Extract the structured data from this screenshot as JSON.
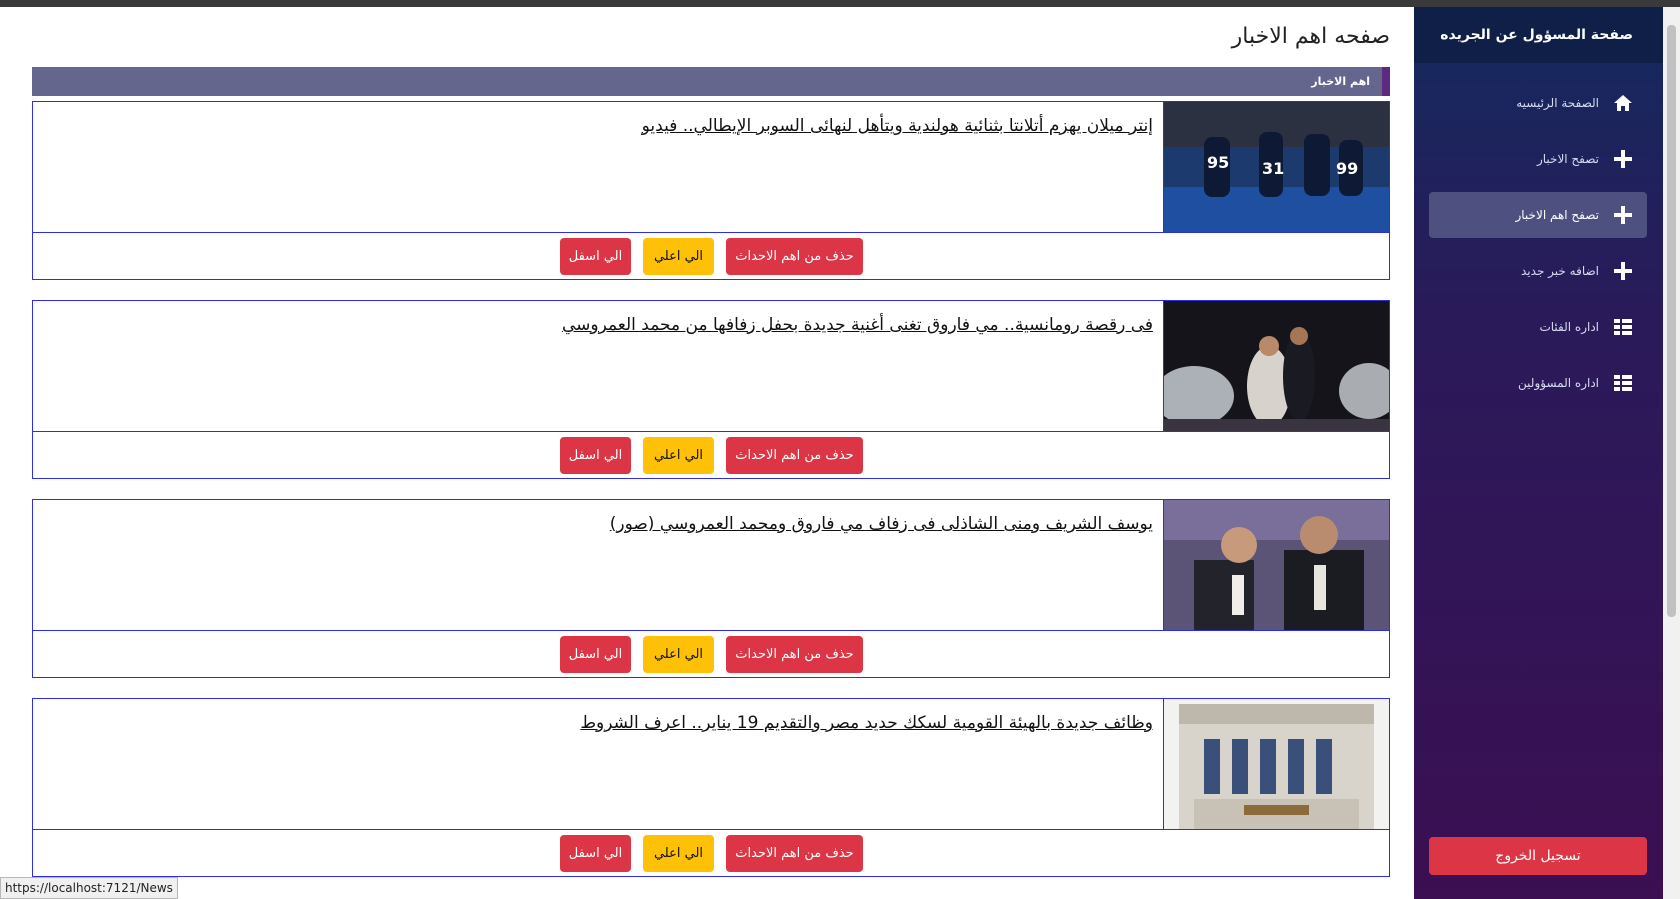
{
  "sidebar": {
    "title": "صفحة المسؤول عن الجريده",
    "items": [
      {
        "label": "الصفحة الرئيسيه",
        "icon": "home-icon"
      },
      {
        "label": "تصفح الاخبار",
        "icon": "plus-icon"
      },
      {
        "label": "تصفح اهم الاخبار",
        "icon": "plus-icon",
        "active": true
      },
      {
        "label": "اضافه خبر جديد",
        "icon": "plus-icon"
      },
      {
        "label": "اداره الفئات",
        "icon": "list-icon"
      },
      {
        "label": "اداره المسؤولين",
        "icon": "list-icon"
      }
    ],
    "logout_label": "تسجيل الخروج"
  },
  "main": {
    "title": "صفحه اهم الاخبار",
    "section_label": "اهم الاخبار",
    "buttons": {
      "remove": "حذف من اهم الاحداث",
      "up": "الي اعلي",
      "down": "الي اسفل"
    },
    "news": [
      {
        "title": "إنتر ميلان يهزم أتلانتا بثنائية هولندية ويتأهل لنهائى السوبر الإيطالي.. فيديو"
      },
      {
        "title": "فى رقصة رومانسية.. مي فاروق تغنى أغنية جديدة بحفل زفافها من محمد العمروسي"
      },
      {
        "title": "يوسف الشريف ومنى الشاذلى فى زفاف مي فاروق ومحمد العمروسي (صور)"
      },
      {
        "title": "وظائف جديدة بالهيئة القومية لسكك حديد مصر والتقديم 19 يناير.. اعرف الشروط"
      }
    ]
  },
  "status_bar": {
    "url": "https://localhost:7121/News"
  },
  "colors": {
    "accent_red": "#dc3545",
    "accent_yellow": "#ffc107",
    "card_border": "#2d2de6",
    "section_bar": "#65668e"
  }
}
